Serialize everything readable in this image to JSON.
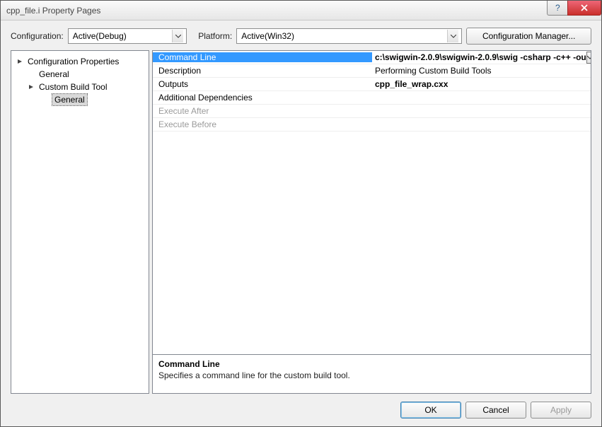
{
  "window": {
    "title": "cpp_file.i Property Pages"
  },
  "topbar": {
    "configuration_label": "Configuration:",
    "configuration_value": "Active(Debug)",
    "platform_label": "Platform:",
    "platform_value": "Active(Win32)",
    "cfg_manager": "Configuration Manager..."
  },
  "tree": {
    "root": "Configuration Properties",
    "general": "General",
    "tool": "Custom Build Tool",
    "tool_general": "General"
  },
  "grid": {
    "rows": [
      {
        "key": "Command Line",
        "val": "c:\\swigwin-2.0.9\\swigwin-2.0.9\\swig -csharp -c++ -ou",
        "selected": true
      },
      {
        "key": "Description",
        "val": "Performing Custom Build Tools"
      },
      {
        "key": "Outputs",
        "val": "cpp_file_wrap.cxx",
        "bold": true
      },
      {
        "key": "Additional Dependencies",
        "val": ""
      },
      {
        "key": "Execute After",
        "val": "",
        "disabled": true
      },
      {
        "key": "Execute Before",
        "val": "",
        "disabled": true
      }
    ]
  },
  "desc": {
    "heading": "Command Line",
    "body": "Specifies a command line for the custom build tool."
  },
  "footer": {
    "ok": "OK",
    "cancel": "Cancel",
    "apply": "Apply"
  }
}
